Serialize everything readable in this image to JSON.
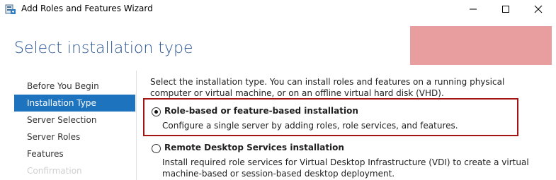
{
  "window": {
    "title": "Add Roles and Features Wizard",
    "icon": "server-manager-icon",
    "controls": [
      "minimize-icon",
      "maximize-icon",
      "close-icon"
    ]
  },
  "header": {
    "page_title": "Select installation type"
  },
  "sidebar": {
    "items": [
      {
        "label": "Before You Begin",
        "state": "normal"
      },
      {
        "label": "Installation Type",
        "state": "active"
      },
      {
        "label": "Server Selection",
        "state": "normal"
      },
      {
        "label": "Server Roles",
        "state": "normal"
      },
      {
        "label": "Features",
        "state": "normal"
      },
      {
        "label": "Confirmation",
        "state": "disabled"
      }
    ]
  },
  "main": {
    "description": "Select the installation type. You can install roles and features on a running physical computer or virtual machine, or on an offline virtual hard disk (VHD).",
    "options": [
      {
        "label": "Role-based or feature-based installation",
        "description": "Configure a single server by adding roles, role services, and features.",
        "selected": true
      },
      {
        "label": "Remote Desktop Services installation",
        "description": "Install required role services for Virtual Desktop Infrastructure (VDI) to create a virtual machine-based or session-based desktop deployment.",
        "selected": false
      }
    ]
  },
  "colors": {
    "title_blue": "#2b5797",
    "active_nav": "#1e73be",
    "highlight_border": "#a31515",
    "redaction": "#e89e9e"
  }
}
